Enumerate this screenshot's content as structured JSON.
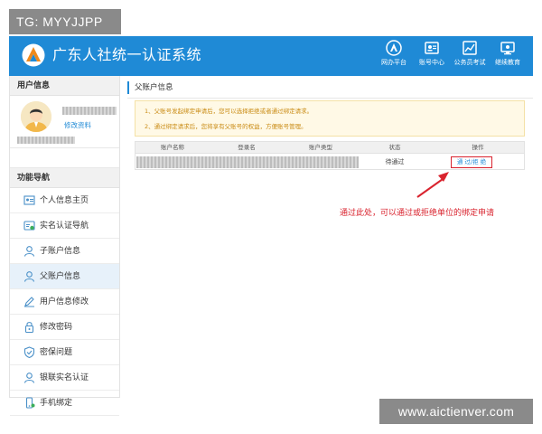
{
  "watermark_top": "TG: MYYJJPP",
  "watermark_bottom": "www.aictienver.com",
  "header": {
    "title": "广东人社统一认证系统",
    "nav": [
      {
        "label": "网办平台",
        "icon": "person-a-icon"
      },
      {
        "label": "账号中心",
        "icon": "id-card-icon"
      },
      {
        "label": "公务员考试",
        "icon": "exam-chart-icon"
      },
      {
        "label": "继续教育",
        "icon": "monitor-icon"
      }
    ]
  },
  "sidebar": {
    "user_section_title": "用户信息",
    "edit_profile": "修改资料",
    "nav_section_title": "功能导航",
    "items": [
      {
        "label": "个人信息主页",
        "icon": "profile-home-icon"
      },
      {
        "label": "实名认证导航",
        "icon": "id-verify-icon"
      },
      {
        "label": "子账户信息",
        "icon": "user-icon"
      },
      {
        "label": "父账户信息",
        "icon": "user-icon",
        "active": true
      },
      {
        "label": "用户信息修改",
        "icon": "pencil-icon"
      },
      {
        "label": "修改密码",
        "icon": "lock-icon"
      },
      {
        "label": "密保问题",
        "icon": "shield-icon"
      },
      {
        "label": "银联实名认证",
        "icon": "user-icon"
      },
      {
        "label": "手机绑定",
        "icon": "phone-icon"
      }
    ]
  },
  "main": {
    "breadcrumb": "父账户信息",
    "notices": [
      "1、父账号发起绑定申请后，您可以选择拒绝或者通过绑定请求。",
      "2、通过绑定请求后，您将享有父账号的权益，方便账号管理。"
    ],
    "table": {
      "headers": [
        "账户名称",
        "登录名",
        "账户类型",
        "状态",
        "操作"
      ],
      "rows": [
        {
          "status": "待通过",
          "action": "通 过/拒 绝"
        }
      ]
    },
    "annotation": "通过此处，可以通过或拒绝单位的绑定申请"
  },
  "colors": {
    "header_bg": "#1f8ad6",
    "accent_red": "#d9232e",
    "notice_text": "#c98a12",
    "active_nav_bg": "#e7f1fa"
  }
}
